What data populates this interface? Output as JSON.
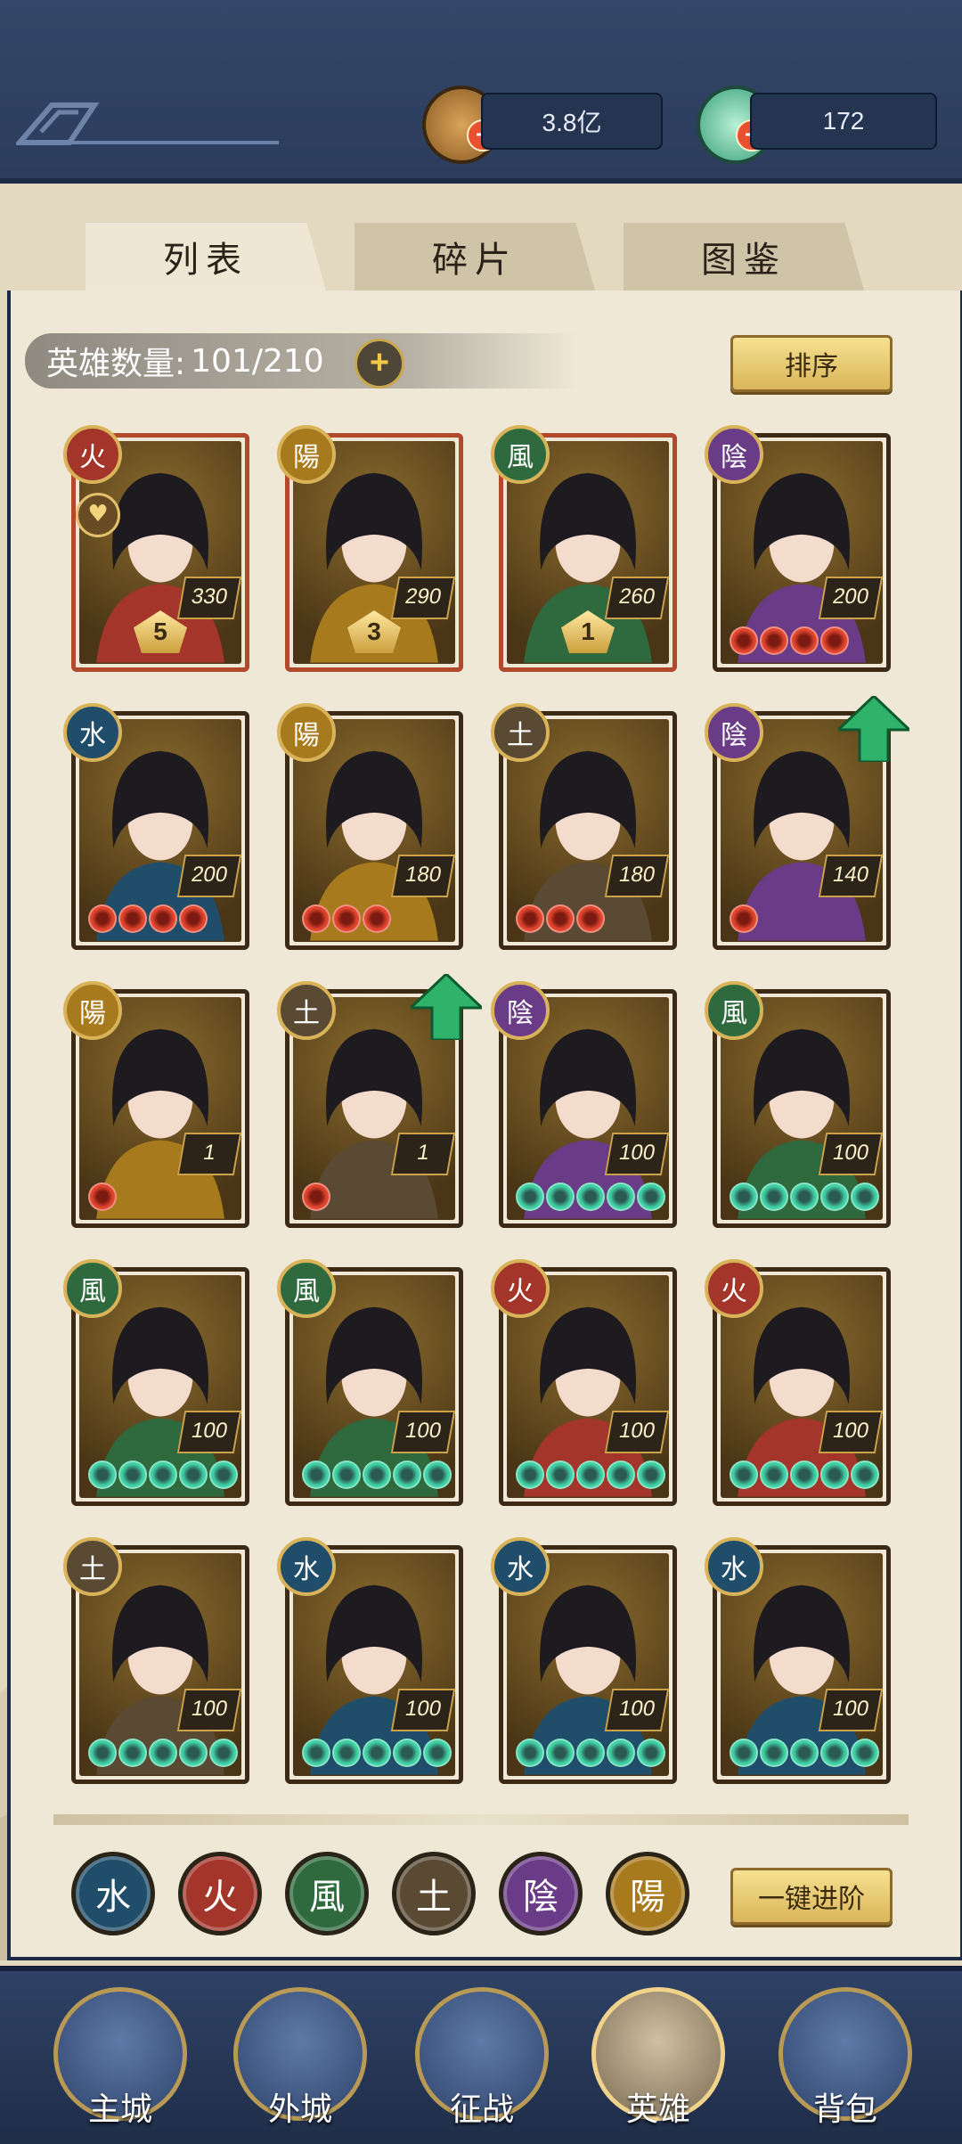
{
  "resources": {
    "coins": "3.8亿",
    "gems": "172"
  },
  "tabs": [
    {
      "label": "列表",
      "active": true
    },
    {
      "label": "碎片",
      "active": false
    },
    {
      "label": "图鉴",
      "active": false
    }
  ],
  "hero_count": {
    "label": "英雄数量:",
    "value": "101/210"
  },
  "sort_button": "排序",
  "advance_button": "一键进阶",
  "element_icons": {
    "fire": "火",
    "water": "水",
    "wind": "風",
    "earth": "土",
    "yin": "陰",
    "yang": "陽"
  },
  "element_colors": {
    "fire": "#a3352a",
    "water": "#1f4d6a",
    "wind": "#2f6a3e",
    "earth": "#5a4a34",
    "yin": "#6a3b86",
    "yang": "#a87a1e"
  },
  "heroes": [
    {
      "element": "火",
      "color": "#a3352a",
      "level": "5",
      "count": "330",
      "favorite": true
    },
    {
      "element": "陽",
      "color": "#a87a1e",
      "level": "3",
      "count": "290"
    },
    {
      "element": "風",
      "color": "#2f6a3e",
      "level": "1",
      "count": "260"
    },
    {
      "element": "陰",
      "color": "#6a3b86",
      "count": "200",
      "stars": 4,
      "star_color": "red"
    },
    {
      "element": "水",
      "color": "#1f4d6a",
      "count": "200",
      "stars": 4,
      "star_color": "red"
    },
    {
      "element": "陽",
      "color": "#a87a1e",
      "count": "180",
      "stars": 3,
      "star_color": "red"
    },
    {
      "element": "土",
      "color": "#5a4a34",
      "count": "180",
      "stars": 3,
      "star_color": "red"
    },
    {
      "element": "陰",
      "color": "#6a3b86",
      "count": "140",
      "stars": 1,
      "star_color": "red",
      "upgrade": true
    },
    {
      "element": "陽",
      "color": "#a87a1e",
      "count": "1",
      "stars": 1,
      "star_color": "red"
    },
    {
      "element": "土",
      "color": "#5a4a34",
      "count": "1",
      "stars": 1,
      "star_color": "red",
      "upgrade": true
    },
    {
      "element": "陰",
      "color": "#6a3b86",
      "count": "100",
      "stars": 5,
      "star_color": "green"
    },
    {
      "element": "風",
      "color": "#2f6a3e",
      "count": "100",
      "stars": 5,
      "star_color": "green"
    },
    {
      "element": "風",
      "color": "#2f6a3e",
      "count": "100",
      "stars": 5,
      "star_color": "green"
    },
    {
      "element": "風",
      "color": "#2f6a3e",
      "count": "100",
      "stars": 5,
      "star_color": "green"
    },
    {
      "element": "火",
      "color": "#a3352a",
      "count": "100",
      "stars": 5,
      "star_color": "green"
    },
    {
      "element": "火",
      "color": "#a3352a",
      "count": "100",
      "stars": 5,
      "star_color": "green"
    },
    {
      "element": "土",
      "color": "#5a4a34",
      "count": "100",
      "stars": 5,
      "star_color": "green"
    },
    {
      "element": "水",
      "color": "#1f4d6a",
      "count": "100",
      "stars": 5,
      "star_color": "green"
    },
    {
      "element": "水",
      "color": "#1f4d6a",
      "count": "100",
      "stars": 5,
      "star_color": "green"
    },
    {
      "element": "水",
      "color": "#1f4d6a",
      "count": "100",
      "stars": 5,
      "star_color": "green"
    }
  ],
  "nav": [
    {
      "label": "主城"
    },
    {
      "label": "外城"
    },
    {
      "label": "征战"
    },
    {
      "label": "英雄",
      "active": true
    },
    {
      "label": "背包"
    }
  ]
}
